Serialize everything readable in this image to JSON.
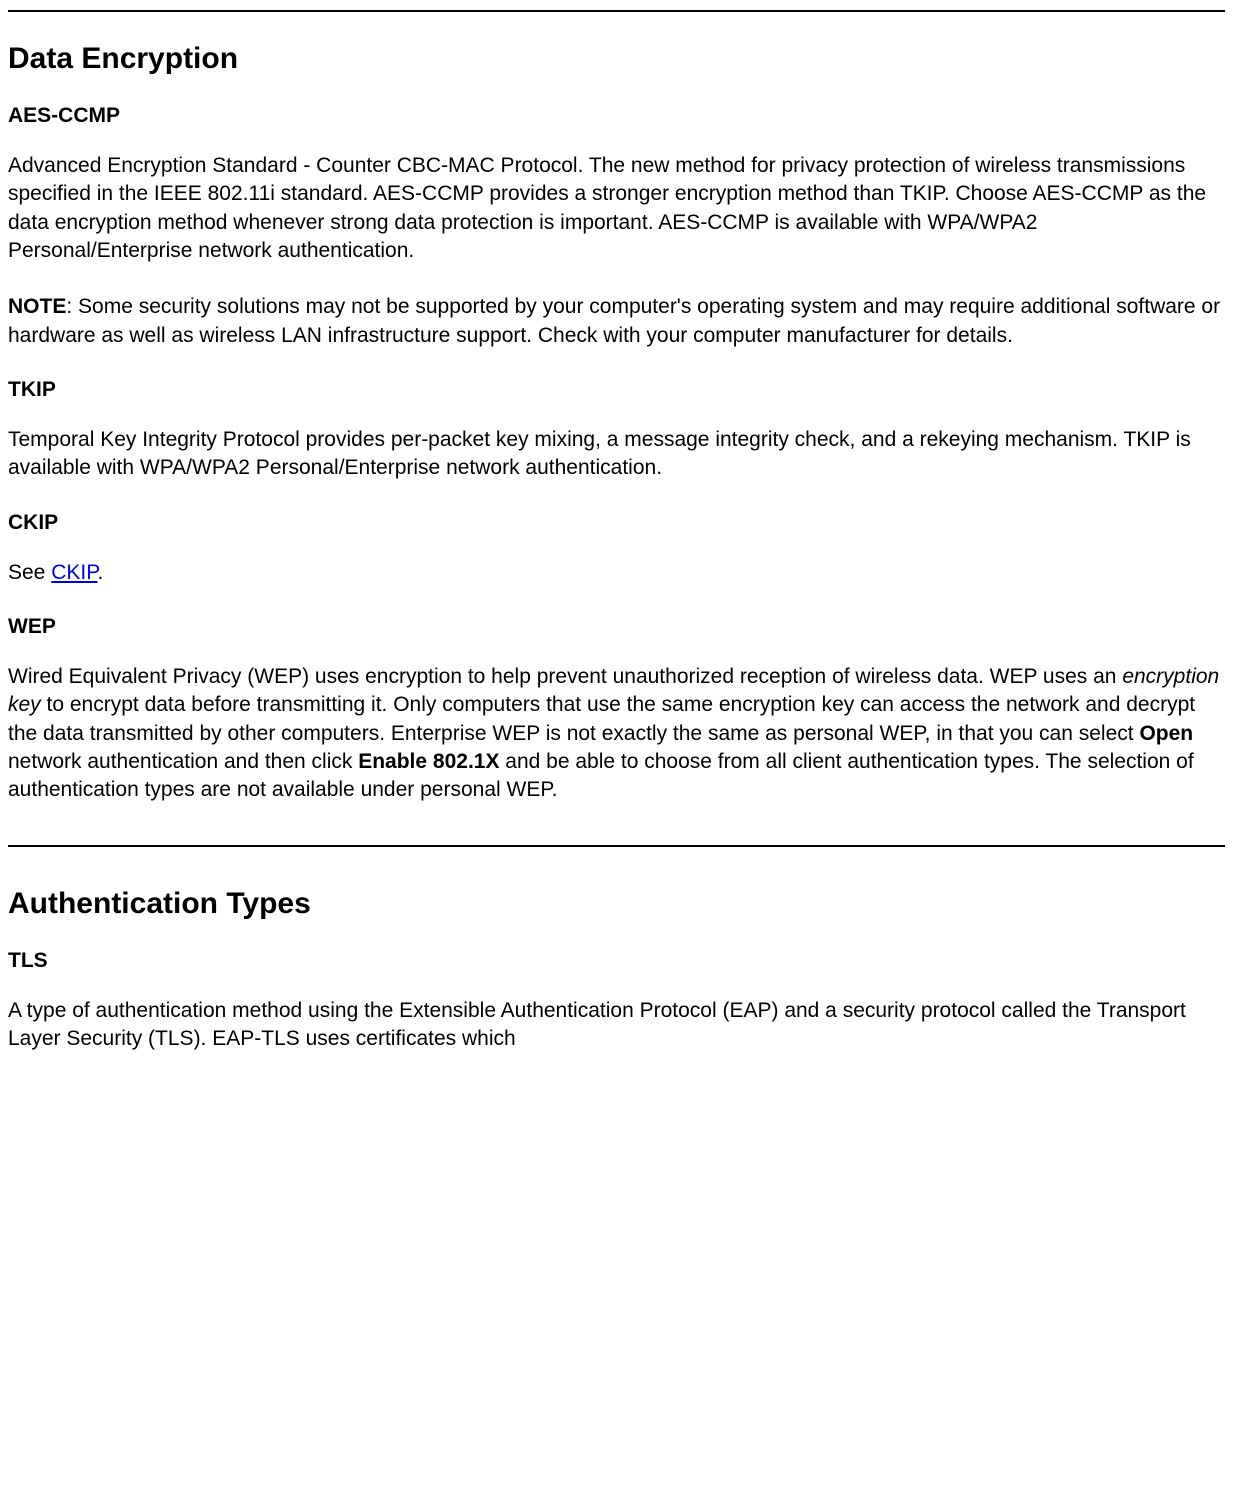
{
  "sections": {
    "data_encryption": {
      "heading": "Data Encryption",
      "aes": {
        "title": "AES-CCMP",
        "body": "Advanced Encryption Standard - Counter CBC-MAC Protocol. The new method for privacy protection of wireless transmissions specified in the IEEE 802.11i standard. AES-CCMP provides a stronger encryption method than TKIP. Choose AES-CCMP as the data encryption method whenever strong data protection is important. AES-CCMP is available with WPA/WPA2 Personal/Enterprise network authentication."
      },
      "note": {
        "label": "NOTE",
        "body": ": Some security solutions may not be supported by your computer's operating system and may require additional software or hardware as well as wireless LAN infrastructure support. Check with your computer manufacturer for details."
      },
      "tkip": {
        "title": "TKIP",
        "body": "Temporal Key Integrity Protocol provides per-packet key mixing, a message integrity check, and a rekeying mechanism. TKIP is available with WPA/WPA2 Personal/Enterprise network authentication."
      },
      "ckip": {
        "title": "CKIP",
        "see": "See ",
        "link": "CKIP",
        "after": "."
      },
      "wep": {
        "title": "WEP",
        "body1": "Wired Equivalent Privacy (WEP) uses encryption to help prevent unauthorized reception of wireless data. WEP uses an ",
        "italic": "encryption key",
        "body2": " to encrypt data before transmitting it. Only computers that use the same encryption key can access the network and decrypt the data transmitted by other computers. Enterprise WEP is not exactly the same as personal WEP, in that you can select ",
        "bold1": "Open",
        "body3": " network authentication and then click ",
        "bold2": "Enable 802.1X",
        "body4": " and be able to choose from all client authentication types. The selection of authentication types are not available under personal WEP."
      }
    },
    "auth_types": {
      "heading": "Authentication Types",
      "tls": {
        "title": "TLS",
        "body": "A type of authentication method using the Extensible Authentication Protocol (EAP) and a security protocol called the Transport Layer Security (TLS). EAP-TLS uses certificates which"
      }
    }
  }
}
